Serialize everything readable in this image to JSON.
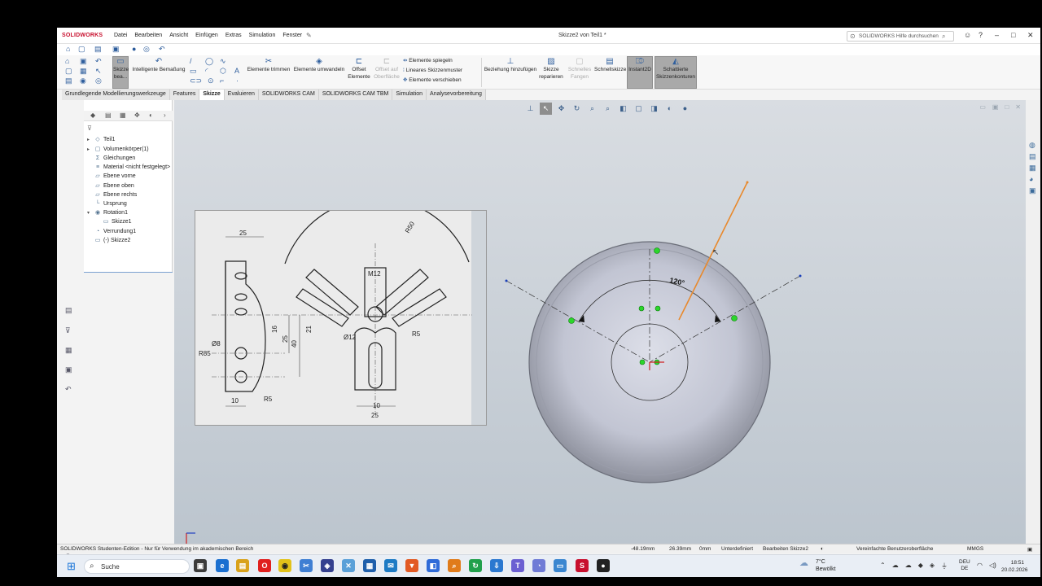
{
  "app": {
    "logo": "SOLIDWORKS",
    "menu": [
      "Datei",
      "Bearbeiten",
      "Ansicht",
      "Einfügen",
      "Extras",
      "Simulation",
      "Fenster"
    ],
    "document_title": "Skizze2 von Teil1 *",
    "help_search_placeholder": "SOLIDWORKS Hilfe durchsuchen"
  },
  "ribbon": {
    "sketch_button": "Skizze bea...",
    "smart_dimension": "Intelligente Bemaßung",
    "trim": "Elemente trimmen",
    "convert": "Elemente umwandeln",
    "offset": "Offset Elemente",
    "offset_surface": "Offset auf Oberfläche",
    "mirror": "Elemente spiegeln",
    "linear_pattern": "Lineares Skizzenmuster",
    "move": "Elemente verschieben",
    "add_relation": "Beziehung hinzufügen",
    "repair": "Skizze reparieren",
    "snaps": "Schnelles Fangen",
    "rapid_sketch": "Schnellskizze",
    "instant2d": "Instant2D",
    "shaded_contours": "Schattierte Skizzenkonturen"
  },
  "tabs": [
    "Grundlegende Modellierungswerkzeuge",
    "Features",
    "Skizze",
    "Evaluieren",
    "SOLIDWORKS CAM",
    "SOLIDWORKS CAM TBM",
    "Simulation",
    "Analysevorbereitung"
  ],
  "active_tab": "Skizze",
  "tree": {
    "root": "Teil1",
    "items": [
      "Volumenkörper(1)",
      "Gleichungen",
      "Material <nicht festgelegt>",
      "Ebene vorne",
      "Ebene oben",
      "Ebene rechts",
      "Ursprung",
      "Rotation1",
      "Skizze1",
      "Verrundung1",
      "(-) Skizze2"
    ]
  },
  "drawing": {
    "dims": [
      "25",
      "R50",
      "M12",
      "40",
      "16",
      "25",
      "21",
      "Ø12",
      "R5",
      "Ø8",
      "R85",
      "R5",
      "10",
      "10",
      "25"
    ]
  },
  "sketch": {
    "angle_label": "120°"
  },
  "status": {
    "edition": "SOLIDWORKS Studenten-Edition - Nur für Verwendung im akademischen Bereich",
    "x": "-48.19mm",
    "y": "26.39mm",
    "z": "0mm",
    "state": "Unterdefiniert",
    "editing": "Bearbeiten Skizze2",
    "ui_mode": "Vereinfachte Benutzeroberfläche",
    "units": "MMGS"
  },
  "taskbar": {
    "search": "Suche",
    "temperature": "7°C",
    "weather": "Bewölkt",
    "lang1": "DEU",
    "lang2": "DE",
    "time": "18:51",
    "date": "20.02.2026"
  }
}
